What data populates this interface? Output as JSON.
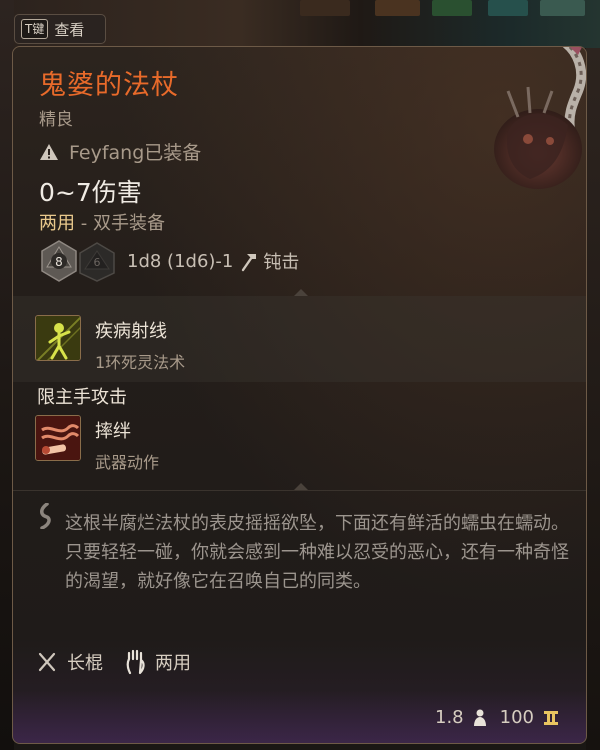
{
  "hint": {
    "key": "T键",
    "label": "查看"
  },
  "item": {
    "name": "鬼婆的法杖",
    "rarity": "精良",
    "equipped_by": "Feyfang已装备",
    "damage": "0~7伤害",
    "hands": "两用",
    "hands_separator": " - ",
    "slot_type": "双手装备",
    "die_main": "8",
    "die_alt": "6",
    "damage_formula": "1d8 (1d6)-1",
    "damage_type": "钝击"
  },
  "abilities": [
    {
      "name": "疾病射线",
      "subtitle": "1环死灵法术",
      "icon": "sickness-ray-icon"
    },
    {
      "name": "摔绊",
      "subtitle": "武器动作",
      "icon": "topple-icon"
    }
  ],
  "mainhand_only": "限主手攻击",
  "description": "这根半腐烂法杖的表皮摇摇欲坠，下面还有鲜活的蠕虫在蠕动。只要轻轻一碰，你就会感到一种难以忍受的恶心，还有一种奇怪的渴望，就好像它在召唤自己的同类。",
  "properties": {
    "weapon_type": "长棍",
    "handedness": "两用"
  },
  "footer": {
    "weight": "1.8",
    "value": "100"
  },
  "colors": {
    "title": "#e86a2a",
    "accent_gold": "#e9c98c",
    "muted": "#a89a8a",
    "border": "#6d5a47"
  }
}
